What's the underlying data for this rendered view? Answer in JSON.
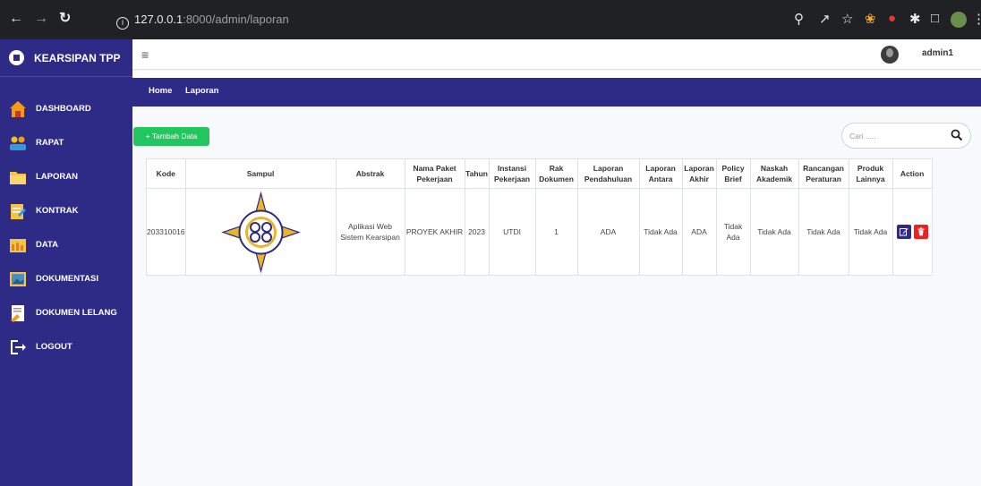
{
  "browser": {
    "url_host": "127.0.0.1",
    "url_path": ":8000/admin/laporan"
  },
  "sidebar": {
    "brand": "KEARSIPAN TPP",
    "items": [
      {
        "label": "DASHBOARD",
        "icon": "home-icon",
        "color": "#f39c12"
      },
      {
        "label": "RAPAT",
        "icon": "meeting-icon",
        "color": "#f1c40f"
      },
      {
        "label": "LAPORAN",
        "icon": "folder-icon",
        "color": "#f6c445"
      },
      {
        "label": "KONTRAK",
        "icon": "contract-icon",
        "color": "#f6c445"
      },
      {
        "label": "DATA",
        "icon": "data-icon",
        "color": "#e67e22"
      },
      {
        "label": "DOKUMENTASI",
        "icon": "photo-icon",
        "color": "#f6c445"
      },
      {
        "label": "DOKUMEN LELANG",
        "icon": "auction-icon",
        "color": "#f6c445"
      },
      {
        "label": "LOGOUT",
        "icon": "logout-icon",
        "color": "#ffffff"
      }
    ]
  },
  "topbar": {
    "username": "admin1"
  },
  "breadcrumb": {
    "home": "Home",
    "current": "Laporan"
  },
  "toolbar": {
    "add_label": "+ Tambah Data",
    "search_placeholder": "Cari ....."
  },
  "table": {
    "headers": [
      "Kode",
      "Sampul",
      "Abstrak",
      "Nama Paket Pekerjaan",
      "Tahun",
      "Instansi Pekerjaan",
      "Rak Dokumen",
      "Laporan Pendahuluan",
      "Laporan Antara",
      "Laporan Akhir",
      "Policy Brief",
      "Naskah Akademik",
      "Rancangan Peraturan",
      "Produk Lainnya",
      "Action"
    ],
    "rows": [
      {
        "kode": "203310016",
        "abstrak": "Aplikasi Web Sistem Kearsipan",
        "nama_paket": "PROYEK AKHIR",
        "tahun": "2023",
        "instansi": "UTDI",
        "rak": "1",
        "pendahuluan": "ADA",
        "antara": "Tidak Ada",
        "akhir": "ADA",
        "policy": "Tidak Ada",
        "naskah": "Tidak Ada",
        "rancangan": "Tidak Ada",
        "produk": "Tidak Ada"
      }
    ]
  },
  "colors": {
    "primary": "#2e2b86",
    "success": "#22c55e",
    "danger": "#ef2020"
  }
}
